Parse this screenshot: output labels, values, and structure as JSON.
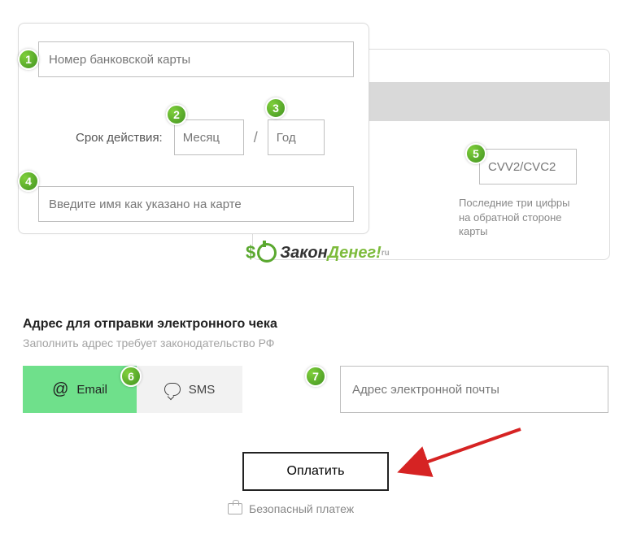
{
  "badges": {
    "n1": "1",
    "n2": "2",
    "n3": "3",
    "n4": "4",
    "n5": "5",
    "n6": "6",
    "n7": "7"
  },
  "card": {
    "number_ph": "Номер банковской карты",
    "expiry_label": "Срок действия:",
    "month_ph": "Месяц",
    "year_ph": "Год",
    "holder_ph": "Введите имя как указано на карте",
    "cvv_ph": "CVV2/CVC2",
    "cvv_hint": "Последние три цифры на обратной стороне карты"
  },
  "logo": {
    "part1": "Закон",
    "part2": " Денег!",
    "tld": "ru"
  },
  "receipt": {
    "title": "Адрес для отправки электронного чека",
    "subtitle": "Заполнить адрес требует законодательство РФ",
    "email_tab": "Email",
    "sms_tab": "SMS",
    "email_ph": "Адрес электронной почты"
  },
  "pay_label": "Оплатить",
  "secure_label": "Безопасный платеж"
}
